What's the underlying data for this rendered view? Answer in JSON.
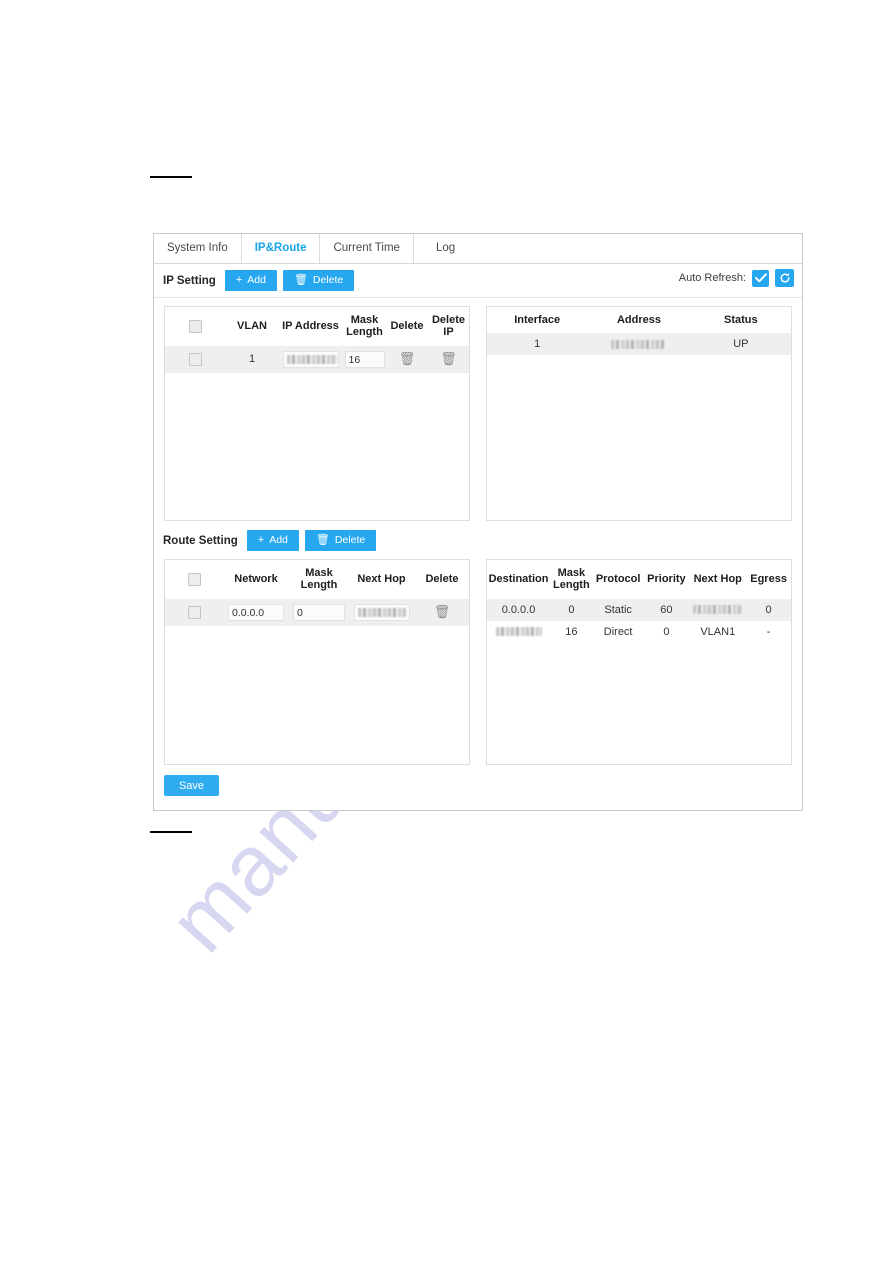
{
  "page": {
    "watermark": "manualshive.com",
    "accent_color": "#26a7f0",
    "active_tab_color": "#1aa3e8"
  },
  "tabs": [
    {
      "label": "System Info",
      "active": false
    },
    {
      "label": "IP&Route",
      "active": true
    },
    {
      "label": "Current Time",
      "active": false
    },
    {
      "label": "Log",
      "active": false
    }
  ],
  "ip_section": {
    "title": "IP Setting",
    "add_label": "Add",
    "add_icon": "plus-icon",
    "delete_label": "Delete",
    "delete_icon": "trash-icon",
    "auto_refresh_label": "Auto Refresh:",
    "auto_refresh_checked": true,
    "refresh_icon": "refresh-icon"
  },
  "ip_config_table": {
    "columns": [
      "",
      "VLAN",
      "IP Address",
      "Mask Length",
      "Delete",
      "Delete IP"
    ],
    "rows": [
      {
        "checked": false,
        "vlan": "1",
        "ip_address": "",
        "ip_address_redacted": true,
        "mask_length": "16",
        "delete_icon": "trash-icon",
        "delete_ip_icon": "trash-icon"
      }
    ]
  },
  "interface_table": {
    "columns": [
      "Interface",
      "Address",
      "Status"
    ],
    "rows": [
      {
        "interface": "1",
        "address": "",
        "address_redacted": true,
        "status": "UP"
      }
    ]
  },
  "route_section": {
    "title": "Route Setting",
    "add_label": "Add",
    "add_icon": "plus-icon",
    "delete_label": "Delete",
    "delete_icon": "trash-icon"
  },
  "route_config_table": {
    "columns": [
      "",
      "Network",
      "Mask Length",
      "Next Hop",
      "Delete"
    ],
    "rows": [
      {
        "checked": false,
        "network": "0.0.0.0",
        "mask_length": "0",
        "next_hop": "",
        "next_hop_redacted": true,
        "delete_icon": "trash-icon"
      }
    ]
  },
  "route_info_table": {
    "columns": [
      "Destination",
      "Mask Length",
      "Protocol",
      "Priority",
      "Next Hop",
      "Egress"
    ],
    "rows": [
      {
        "destination": "0.0.0.0",
        "destination_redacted": false,
        "mask_length": "0",
        "protocol": "Static",
        "priority": "60",
        "next_hop": "",
        "next_hop_redacted": true,
        "egress": "0"
      },
      {
        "destination": "",
        "destination_redacted": true,
        "mask_length": "16",
        "protocol": "Direct",
        "priority": "0",
        "next_hop": "VLAN1",
        "next_hop_redacted": false,
        "egress": "-"
      }
    ]
  },
  "footer": {
    "save_label": "Save"
  }
}
